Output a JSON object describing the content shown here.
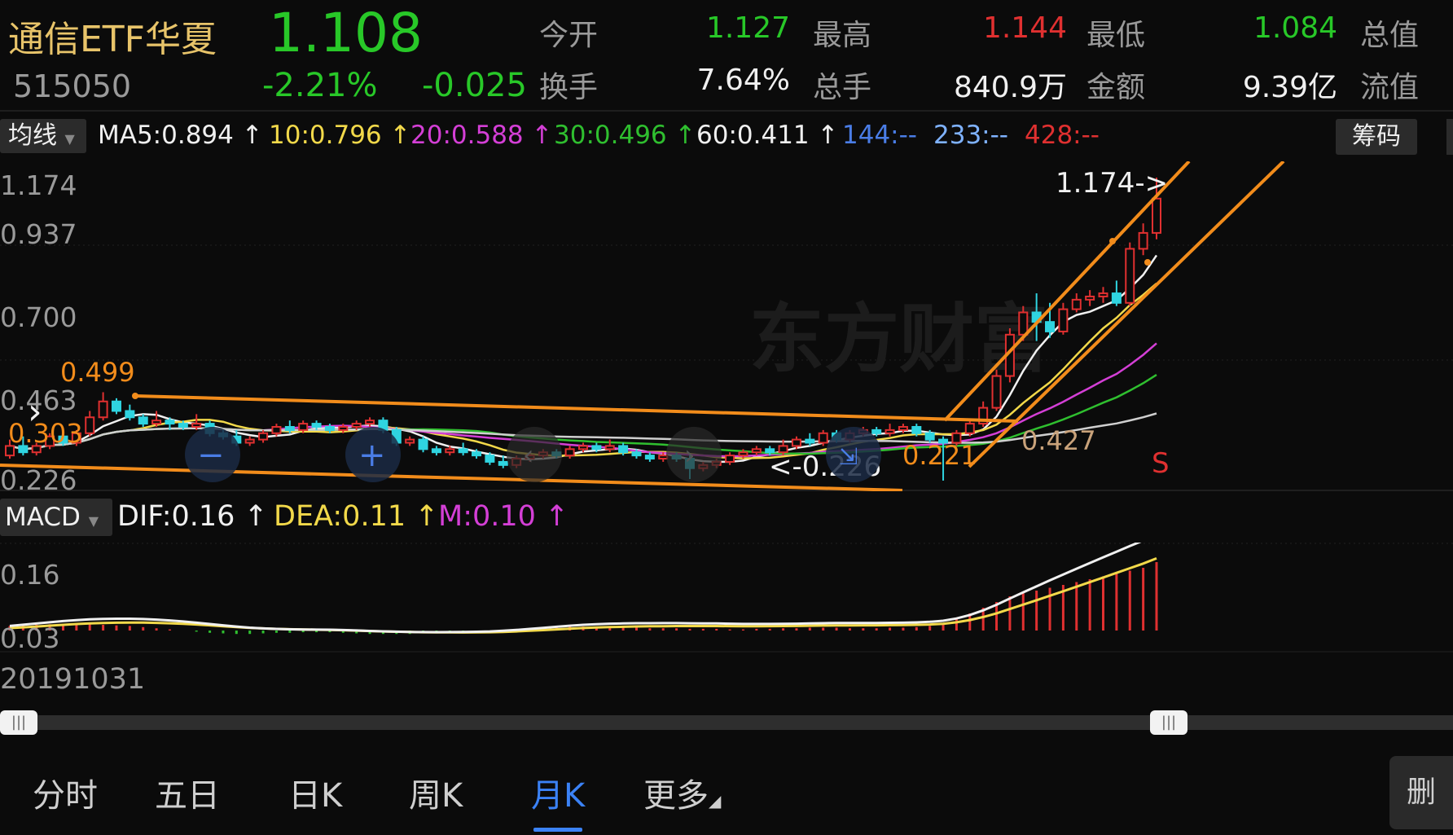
{
  "header": {
    "name": "通信ETF华夏",
    "price": "1.108",
    "code": "515050",
    "change_pct": "-2.21%",
    "change_val": "-0.025",
    "fields": [
      {
        "label": "今开",
        "value": "1.127",
        "color": "green"
      },
      {
        "label": "最高",
        "value": "1.144",
        "color": "red"
      },
      {
        "label": "最低",
        "value": "1.084",
        "color": "green"
      },
      {
        "label": "总值",
        "value": ""
      },
      {
        "label": "换手",
        "value": "7.64%",
        "color": "white"
      },
      {
        "label": "总手",
        "value": "840.9万",
        "color": "white"
      },
      {
        "label": "金额",
        "value": "9.39亿",
        "color": "white"
      },
      {
        "label": "流值",
        "value": ""
      }
    ]
  },
  "ma_bar": {
    "button": "均线",
    "items": [
      {
        "text": "MA5:0.894 ↑",
        "color": "#f0f0f0"
      },
      {
        "text": "10:0.796 ↑",
        "color": "#f2d94a"
      },
      {
        "text": "20:0.588 ↑",
        "color": "#d43fd6"
      },
      {
        "text": "30:0.496 ↑",
        "color": "#2fbf2f"
      },
      {
        "text": "60:0.411 ↑",
        "color": "#f0f0f0"
      },
      {
        "text": "144:--",
        "color": "#4a7de6"
      },
      {
        "text": "233:--",
        "color": "#7fb2ff"
      },
      {
        "text": "428:--",
        "color": "#e03030"
      }
    ],
    "chip_button": "筹码"
  },
  "price_axis": [
    "1.174",
    "0.937",
    "0.700",
    "0.463",
    "0.226"
  ],
  "annotations": {
    "high_label": "1.174->",
    "low_label": "<-0.226",
    "left_high": "0.499",
    "left_low": "0.303",
    "mid_low": "0.221",
    "mid_val": "0.427",
    "signal": "S",
    "watermark": "东方财富"
  },
  "macd_bar": {
    "button": "MACD",
    "dif": "DIF:0.16 ↑",
    "dea": "DEA:0.11 ↑",
    "m": "M:0.10 ↑"
  },
  "macd_axis": [
    "0.16",
    "0.03"
  ],
  "start_date": "20191031",
  "tabs": [
    {
      "label": "分时"
    },
    {
      "label": "五日"
    },
    {
      "label": "日K"
    },
    {
      "label": "周K"
    },
    {
      "label": "月K",
      "active": true
    },
    {
      "label": "更多"
    }
  ],
  "delete_button": "删",
  "chart_data": {
    "type": "candlestick",
    "period": "monthly",
    "ylim": [
      0.226,
      1.174
    ],
    "candles": [
      {
        "o": 0.3,
        "c": 0.33,
        "h": 0.35,
        "l": 0.29
      },
      {
        "o": 0.33,
        "c": 0.31,
        "h": 0.36,
        "l": 0.3
      },
      {
        "o": 0.31,
        "c": 0.33,
        "h": 0.34,
        "l": 0.3
      },
      {
        "o": 0.33,
        "c": 0.36,
        "h": 0.37,
        "l": 0.32
      },
      {
        "o": 0.36,
        "c": 0.34,
        "h": 0.38,
        "l": 0.33
      },
      {
        "o": 0.34,
        "c": 0.37,
        "h": 0.38,
        "l": 0.33
      },
      {
        "o": 0.37,
        "c": 0.42,
        "h": 0.44,
        "l": 0.36
      },
      {
        "o": 0.42,
        "c": 0.47,
        "h": 0.499,
        "l": 0.41
      },
      {
        "o": 0.47,
        "c": 0.44,
        "h": 0.48,
        "l": 0.43
      },
      {
        "o": 0.44,
        "c": 0.42,
        "h": 0.46,
        "l": 0.41
      },
      {
        "o": 0.42,
        "c": 0.4,
        "h": 0.43,
        "l": 0.39
      },
      {
        "o": 0.4,
        "c": 0.41,
        "h": 0.44,
        "l": 0.39
      },
      {
        "o": 0.41,
        "c": 0.4,
        "h": 0.42,
        "l": 0.38
      },
      {
        "o": 0.4,
        "c": 0.39,
        "h": 0.41,
        "l": 0.38
      },
      {
        "o": 0.39,
        "c": 0.4,
        "h": 0.43,
        "l": 0.38
      },
      {
        "o": 0.4,
        "c": 0.37,
        "h": 0.41,
        "l": 0.36
      },
      {
        "o": 0.37,
        "c": 0.36,
        "h": 0.38,
        "l": 0.35
      },
      {
        "o": 0.36,
        "c": 0.34,
        "h": 0.38,
        "l": 0.33
      },
      {
        "o": 0.34,
        "c": 0.35,
        "h": 0.36,
        "l": 0.33
      },
      {
        "o": 0.35,
        "c": 0.37,
        "h": 0.38,
        "l": 0.34
      },
      {
        "o": 0.37,
        "c": 0.39,
        "h": 0.4,
        "l": 0.36
      },
      {
        "o": 0.39,
        "c": 0.38,
        "h": 0.41,
        "l": 0.37
      },
      {
        "o": 0.38,
        "c": 0.4,
        "h": 0.41,
        "l": 0.37
      },
      {
        "o": 0.4,
        "c": 0.39,
        "h": 0.41,
        "l": 0.38
      },
      {
        "o": 0.39,
        "c": 0.38,
        "h": 0.4,
        "l": 0.37
      },
      {
        "o": 0.38,
        "c": 0.39,
        "h": 0.4,
        "l": 0.37
      },
      {
        "o": 0.39,
        "c": 0.4,
        "h": 0.41,
        "l": 0.38
      },
      {
        "o": 0.4,
        "c": 0.41,
        "h": 0.42,
        "l": 0.39
      },
      {
        "o": 0.41,
        "c": 0.38,
        "h": 0.42,
        "l": 0.37
      },
      {
        "o": 0.38,
        "c": 0.34,
        "h": 0.39,
        "l": 0.33
      },
      {
        "o": 0.34,
        "c": 0.35,
        "h": 0.36,
        "l": 0.33
      },
      {
        "o": 0.35,
        "c": 0.32,
        "h": 0.36,
        "l": 0.31
      },
      {
        "o": 0.32,
        "c": 0.31,
        "h": 0.33,
        "l": 0.3
      },
      {
        "o": 0.31,
        "c": 0.32,
        "h": 0.33,
        "l": 0.3
      },
      {
        "o": 0.32,
        "c": 0.31,
        "h": 0.34,
        "l": 0.3
      },
      {
        "o": 0.31,
        "c": 0.3,
        "h": 0.32,
        "l": 0.29
      },
      {
        "o": 0.3,
        "c": 0.28,
        "h": 0.31,
        "l": 0.27
      },
      {
        "o": 0.28,
        "c": 0.27,
        "h": 0.3,
        "l": 0.26
      },
      {
        "o": 0.27,
        "c": 0.29,
        "h": 0.3,
        "l": 0.26
      },
      {
        "o": 0.29,
        "c": 0.3,
        "h": 0.31,
        "l": 0.28
      },
      {
        "o": 0.3,
        "c": 0.31,
        "h": 0.32,
        "l": 0.29
      },
      {
        "o": 0.31,
        "c": 0.3,
        "h": 0.32,
        "l": 0.29
      },
      {
        "o": 0.3,
        "c": 0.32,
        "h": 0.33,
        "l": 0.29
      },
      {
        "o": 0.32,
        "c": 0.33,
        "h": 0.34,
        "l": 0.31
      },
      {
        "o": 0.33,
        "c": 0.32,
        "h": 0.34,
        "l": 0.31
      },
      {
        "o": 0.32,
        "c": 0.33,
        "h": 0.35,
        "l": 0.31
      },
      {
        "o": 0.33,
        "c": 0.31,
        "h": 0.34,
        "l": 0.3
      },
      {
        "o": 0.31,
        "c": 0.3,
        "h": 0.32,
        "l": 0.29
      },
      {
        "o": 0.3,
        "c": 0.29,
        "h": 0.31,
        "l": 0.28
      },
      {
        "o": 0.29,
        "c": 0.3,
        "h": 0.31,
        "l": 0.28
      },
      {
        "o": 0.3,
        "c": 0.29,
        "h": 0.31,
        "l": 0.28
      },
      {
        "o": 0.29,
        "c": 0.26,
        "h": 0.3,
        "l": 0.226
      },
      {
        "o": 0.26,
        "c": 0.27,
        "h": 0.28,
        "l": 0.25
      },
      {
        "o": 0.27,
        "c": 0.28,
        "h": 0.29,
        "l": 0.26
      },
      {
        "o": 0.28,
        "c": 0.3,
        "h": 0.31,
        "l": 0.27
      },
      {
        "o": 0.3,
        "c": 0.31,
        "h": 0.32,
        "l": 0.29
      },
      {
        "o": 0.31,
        "c": 0.32,
        "h": 0.33,
        "l": 0.3
      },
      {
        "o": 0.32,
        "c": 0.31,
        "h": 0.33,
        "l": 0.3
      },
      {
        "o": 0.31,
        "c": 0.33,
        "h": 0.35,
        "l": 0.3
      },
      {
        "o": 0.33,
        "c": 0.35,
        "h": 0.36,
        "l": 0.32
      },
      {
        "o": 0.35,
        "c": 0.34,
        "h": 0.37,
        "l": 0.33
      },
      {
        "o": 0.34,
        "c": 0.37,
        "h": 0.38,
        "l": 0.33
      },
      {
        "o": 0.37,
        "c": 0.35,
        "h": 0.38,
        "l": 0.34
      },
      {
        "o": 0.35,
        "c": 0.37,
        "h": 0.38,
        "l": 0.34
      },
      {
        "o": 0.37,
        "c": 0.38,
        "h": 0.39,
        "l": 0.36
      },
      {
        "o": 0.38,
        "c": 0.37,
        "h": 0.39,
        "l": 0.36
      },
      {
        "o": 0.37,
        "c": 0.38,
        "h": 0.4,
        "l": 0.36
      },
      {
        "o": 0.38,
        "c": 0.39,
        "h": 0.4,
        "l": 0.37
      },
      {
        "o": 0.39,
        "c": 0.37,
        "h": 0.4,
        "l": 0.36
      },
      {
        "o": 0.37,
        "c": 0.35,
        "h": 0.38,
        "l": 0.34
      },
      {
        "o": 0.35,
        "c": 0.34,
        "h": 0.36,
        "l": 0.221
      },
      {
        "o": 0.34,
        "c": 0.37,
        "h": 0.38,
        "l": 0.33
      },
      {
        "o": 0.37,
        "c": 0.4,
        "h": 0.41,
        "l": 0.36
      },
      {
        "o": 0.4,
        "c": 0.45,
        "h": 0.47,
        "l": 0.39
      },
      {
        "o": 0.45,
        "c": 0.55,
        "h": 0.57,
        "l": 0.44
      },
      {
        "o": 0.55,
        "c": 0.68,
        "h": 0.7,
        "l": 0.53
      },
      {
        "o": 0.68,
        "c": 0.75,
        "h": 0.77,
        "l": 0.66
      },
      {
        "o": 0.75,
        "c": 0.72,
        "h": 0.81,
        "l": 0.66
      },
      {
        "o": 0.72,
        "c": 0.69,
        "h": 0.78,
        "l": 0.67
      },
      {
        "o": 0.69,
        "c": 0.76,
        "h": 0.78,
        "l": 0.68
      },
      {
        "o": 0.76,
        "c": 0.79,
        "h": 0.81,
        "l": 0.75
      },
      {
        "o": 0.79,
        "c": 0.8,
        "h": 0.82,
        "l": 0.77
      },
      {
        "o": 0.8,
        "c": 0.81,
        "h": 0.83,
        "l": 0.78
      },
      {
        "o": 0.81,
        "c": 0.78,
        "h": 0.85,
        "l": 0.77
      },
      {
        "o": 0.78,
        "c": 0.95,
        "h": 0.97,
        "l": 0.77
      },
      {
        "o": 0.95,
        "c": 1.0,
        "h": 1.03,
        "l": 0.93
      },
      {
        "o": 1.0,
        "c": 1.108,
        "h": 1.174,
        "l": 0.98
      }
    ],
    "macd_hist": [
      0.008,
      0.009,
      0.01,
      0.011,
      0.012,
      0.012,
      0.011,
      0.01,
      0.009,
      0.008,
      0.006,
      0.004,
      0.002,
      0,
      -0.002,
      -0.004,
      -0.005,
      -0.006,
      -0.006,
      -0.005,
      -0.004,
      -0.004,
      -0.003,
      -0.003,
      -0.003,
      -0.004,
      -0.005,
      -0.006,
      -0.006,
      -0.006,
      -0.006,
      -0.005,
      -0.005,
      -0.004,
      -0.004,
      -0.003,
      -0.002,
      0,
      0.002,
      0.004,
      0.005,
      0.006,
      0.007,
      0.007,
      0.006,
      0.006,
      0.005,
      0.005,
      0.004,
      0.004,
      0.004,
      0.003,
      0.003,
      0.003,
      0.002,
      0.002,
      0.003,
      0.003,
      0.004,
      0.004,
      0.005,
      0.005,
      0.005,
      0.004,
      0.004,
      0.004,
      0.005,
      0.005,
      0.006,
      0.008,
      0.012,
      0.02,
      0.03,
      0.04,
      0.05,
      0.06,
      0.065,
      0.07,
      0.075,
      0.08,
      0.085,
      0.09,
      0.095,
      0.1,
      0.105,
      0.11,
      0.12
    ]
  }
}
